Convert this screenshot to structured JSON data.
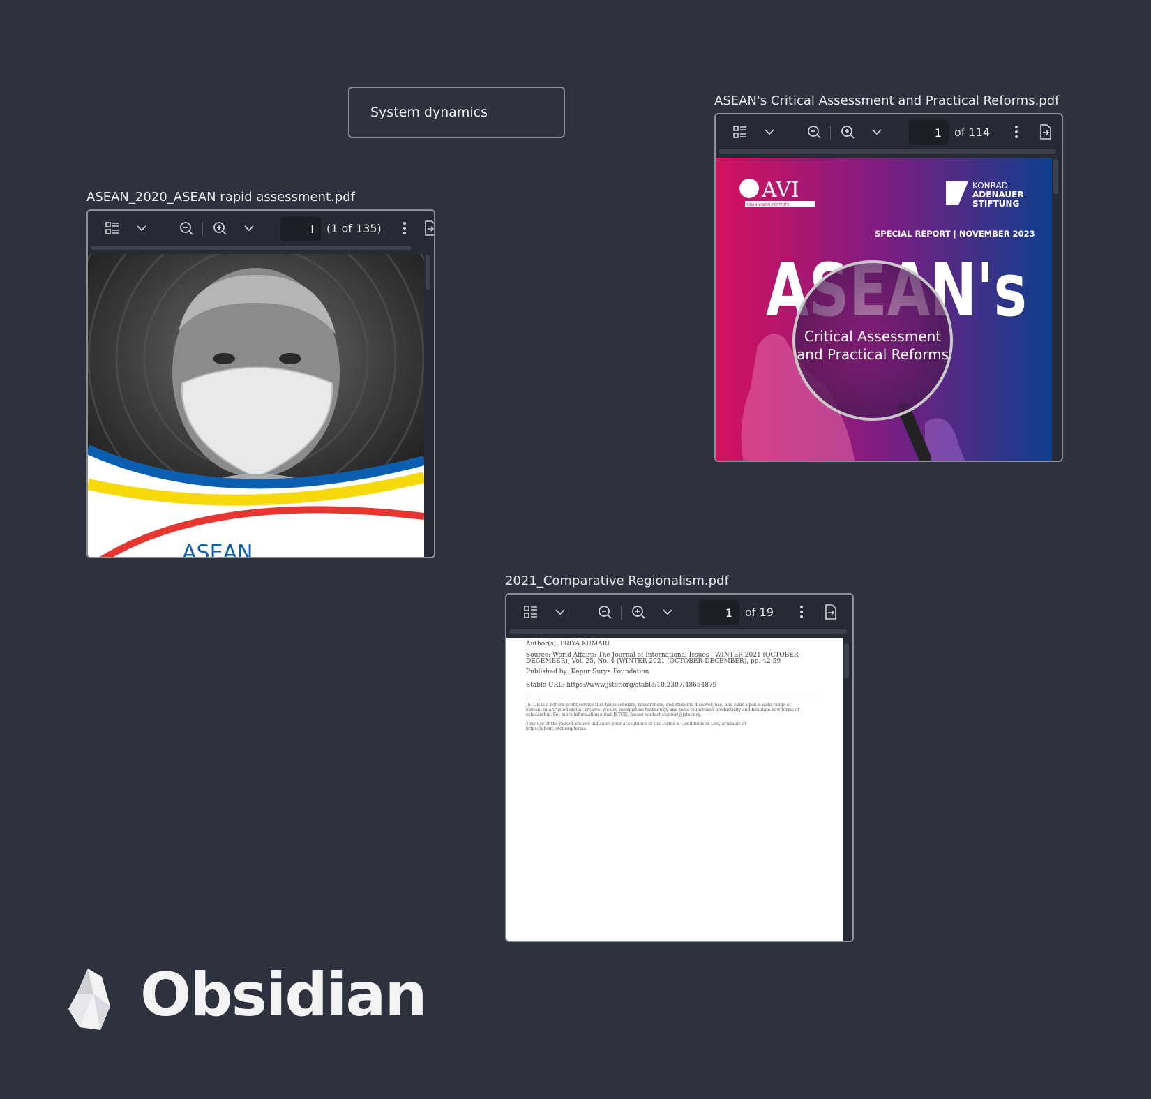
{
  "canvas": {
    "card_text": "System dynamics"
  },
  "pdf1": {
    "filename": "ASEAN_2020_ASEAN rapid assessment.pdf",
    "page_input": "I",
    "page_count": "(1 of 135)",
    "cover_text": "ASEAN"
  },
  "pdf2": {
    "filename": "ASEAN's Critical Assessment and Practical Reforms.pdf",
    "page_input": "1",
    "page_count": "of 114",
    "cover": {
      "logo_left": "AVI",
      "logo_left_sub": "ASIAN VISION INSTITUTE",
      "logo_right_line1": "KONRAD",
      "logo_right_line2": "ADENAUER",
      "logo_right_line3": "STIFTUNG",
      "tag": "SPECIAL REPORT | NOVEMBER 2023",
      "headline": "ASEAN's",
      "subtitle_line1": "Critical Assessment",
      "subtitle_line2": "and Practical Reforms"
    }
  },
  "pdf3": {
    "filename": "2021_Comparative Regionalism.pdf",
    "page_input": "1",
    "page_count": "of 19",
    "doc": {
      "authors": "Author(s): PRIYA KUMARI",
      "source_line1": "Source: World Affairs: The Journal of International Issues , WINTER 2021 (OCTOBER-",
      "source_line2": "DECEMBER), Vol. 25, No. 4 (WINTER 2021 (OCTOBER-DECEMBER), pp. 42-59",
      "publisher": "Published by: Kapur Surya Foundation",
      "stable_url": "Stable URL: https://www.jstor.org/stable/10.2307/48654879",
      "jstor_notice": "JSTOR is a not-for-profit service that helps scholars, researchers, and students discover, use, and build upon a wide range of content in a trusted digital archive. We use information technology and tools to increase productivity and facilitate new forms of scholarship. For more information about JSTOR, please contact support@jstor.org.",
      "terms_notice": "Your use of the JSTOR archive indicates your acceptance of the Terms & Conditions of Use, available at https://about.jstor.org/terms"
    }
  },
  "brand": {
    "name": "Obsidian"
  },
  "colors": {
    "background": "#2d323e",
    "border": "#8a8f99",
    "cover_magenta": "#d6115e",
    "cover_blue": "#0f3f8c",
    "asean_blue": "#0b5fb3",
    "asean_yellow": "#f5d90a",
    "asean_red": "#e8352f"
  }
}
